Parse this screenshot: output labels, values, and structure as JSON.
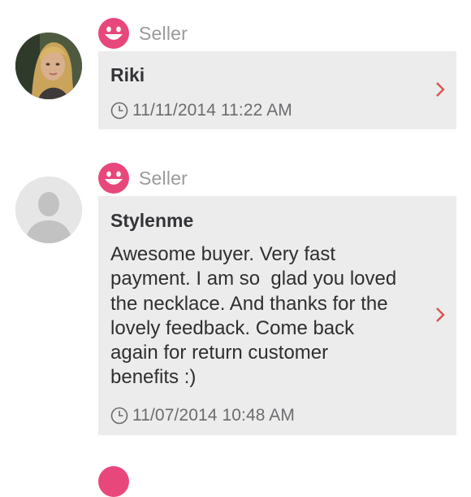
{
  "colors": {
    "accent": "#e8477c",
    "chevron": "#d9534f",
    "card_bg": "#ececec"
  },
  "reviews": [
    {
      "role_icon": "smile-face-icon",
      "role": "Seller",
      "name": "Riki",
      "comment": "",
      "timestamp": "11/11/2014 11:22 AM"
    },
    {
      "role_icon": "smile-face-icon",
      "role": "Seller",
      "name": "Stylenme",
      "comment": "Awesome buyer. Very fast\npayment. I am so  glad you loved\nthe necklace. And thanks for the\nlovely feedback. Come back\nagain for return customer\nbenefits :)",
      "timestamp": "11/07/2014 10:48 AM"
    }
  ]
}
